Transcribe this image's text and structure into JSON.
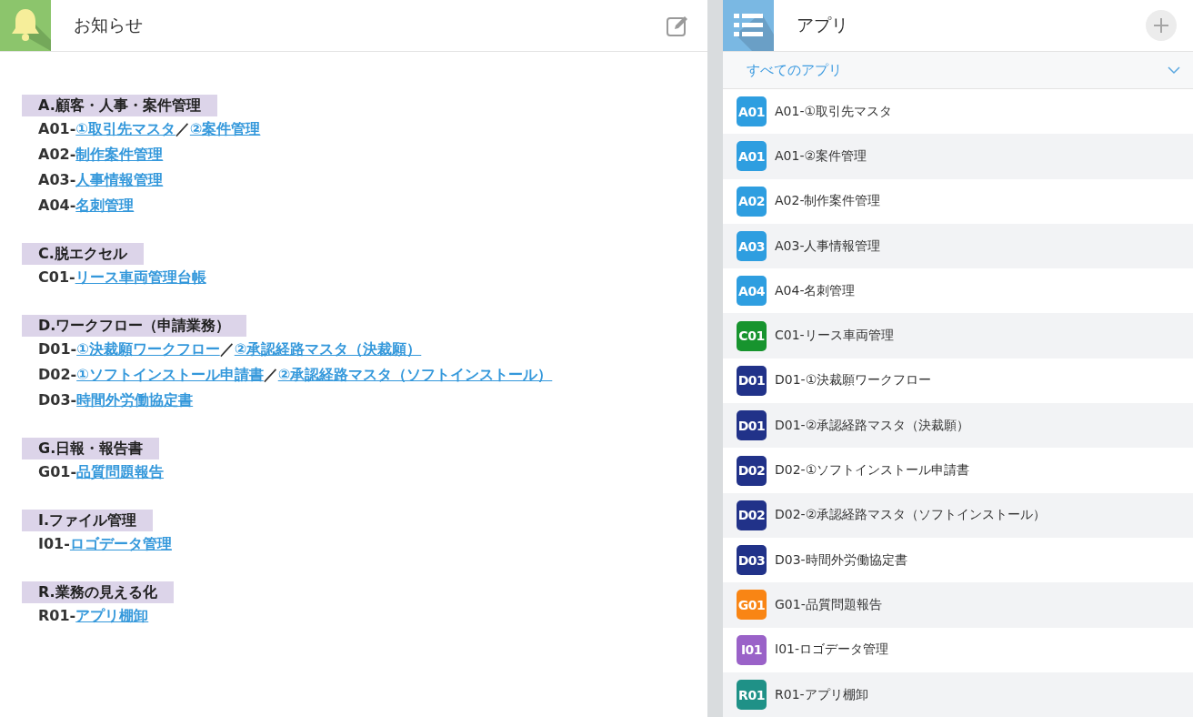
{
  "notice_panel": {
    "title": "お知らせ",
    "sections": [
      {
        "heading": "A.顧客・人事・案件管理",
        "items": [
          {
            "code": "A01-",
            "parts": [
              {
                "kind": "link",
                "text": "①取引先マスタ"
              },
              {
                "kind": "text",
                "text": "／"
              },
              {
                "kind": "link",
                "text": "②案件管理"
              }
            ]
          },
          {
            "code": "A02-",
            "parts": [
              {
                "kind": "link",
                "text": "制作案件管理"
              }
            ]
          },
          {
            "code": "A03-",
            "parts": [
              {
                "kind": "link",
                "text": "人事情報管理"
              }
            ]
          },
          {
            "code": "A04-",
            "parts": [
              {
                "kind": "link",
                "text": "名刺管理"
              }
            ]
          }
        ]
      },
      {
        "heading": "C.脱エクセル",
        "items": [
          {
            "code": "C01-",
            "parts": [
              {
                "kind": "link",
                "text": "リース車両管理台帳"
              }
            ]
          }
        ]
      },
      {
        "heading": "D.ワークフロー（申請業務）",
        "items": [
          {
            "code": "D01-",
            "parts": [
              {
                "kind": "link",
                "text": "①決裁願ワークフロー"
              },
              {
                "kind": "text",
                "text": "／"
              },
              {
                "kind": "link",
                "text": "②承認経路マスタ（決裁願）"
              }
            ]
          },
          {
            "code": "D02-",
            "parts": [
              {
                "kind": "link",
                "text": "①ソフトインストール申請書"
              },
              {
                "kind": "text",
                "text": "／"
              },
              {
                "kind": "link",
                "text": "②承認経路マスタ（ソフトインストール）"
              }
            ]
          },
          {
            "code": "D03-",
            "parts": [
              {
                "kind": "link",
                "text": "時間外労働協定書"
              }
            ]
          }
        ]
      },
      {
        "heading": "G.日報・報告書",
        "items": [
          {
            "code": "G01-",
            "parts": [
              {
                "kind": "link",
                "text": "品質問題報告"
              }
            ]
          }
        ]
      },
      {
        "heading": "I.ファイル管理",
        "items": [
          {
            "code": "I01-",
            "parts": [
              {
                "kind": "link",
                "text": "ロゴデータ管理"
              }
            ]
          }
        ]
      },
      {
        "heading": "R.業務の見える化",
        "items": [
          {
            "code": "R01-",
            "parts": [
              {
                "kind": "link",
                "text": "アプリ棚卸"
              }
            ]
          }
        ]
      }
    ]
  },
  "apps_panel": {
    "title": "アプリ",
    "filter": "すべてのアプリ",
    "apps": [
      {
        "badge": "A01",
        "name": "A01-①取引先マスタ",
        "color": "#2e9ee0"
      },
      {
        "badge": "A01",
        "name": "A01-②案件管理",
        "color": "#2e9ee0"
      },
      {
        "badge": "A02",
        "name": "A02-制作案件管理",
        "color": "#2e9ee0"
      },
      {
        "badge": "A03",
        "name": "A03-人事情報管理",
        "color": "#2e9ee0"
      },
      {
        "badge": "A04",
        "name": "A04-名刺管理",
        "color": "#2e9ee0"
      },
      {
        "badge": "C01",
        "name": "C01-リース車両管理",
        "color": "#17942e"
      },
      {
        "badge": "D01",
        "name": "D01-①決裁願ワークフロー",
        "color": "#213289"
      },
      {
        "badge": "D01",
        "name": "D01-②承認経路マスタ（決裁願）",
        "color": "#213289"
      },
      {
        "badge": "D02",
        "name": "D02-①ソフトインストール申請書",
        "color": "#213289"
      },
      {
        "badge": "D02",
        "name": "D02-②承認経路マスタ（ソフトインストール）",
        "color": "#213289"
      },
      {
        "badge": "D03",
        "name": "D03-時間外労働協定書",
        "color": "#213289"
      },
      {
        "badge": "G01",
        "name": "G01-品質問題報告",
        "color": "#f98514"
      },
      {
        "badge": "I01",
        "name": "I01-ロゴデータ管理",
        "color": "#9a62c8"
      },
      {
        "badge": "R01",
        "name": "R01-アプリ棚卸",
        "color": "#1f9187"
      }
    ]
  }
}
